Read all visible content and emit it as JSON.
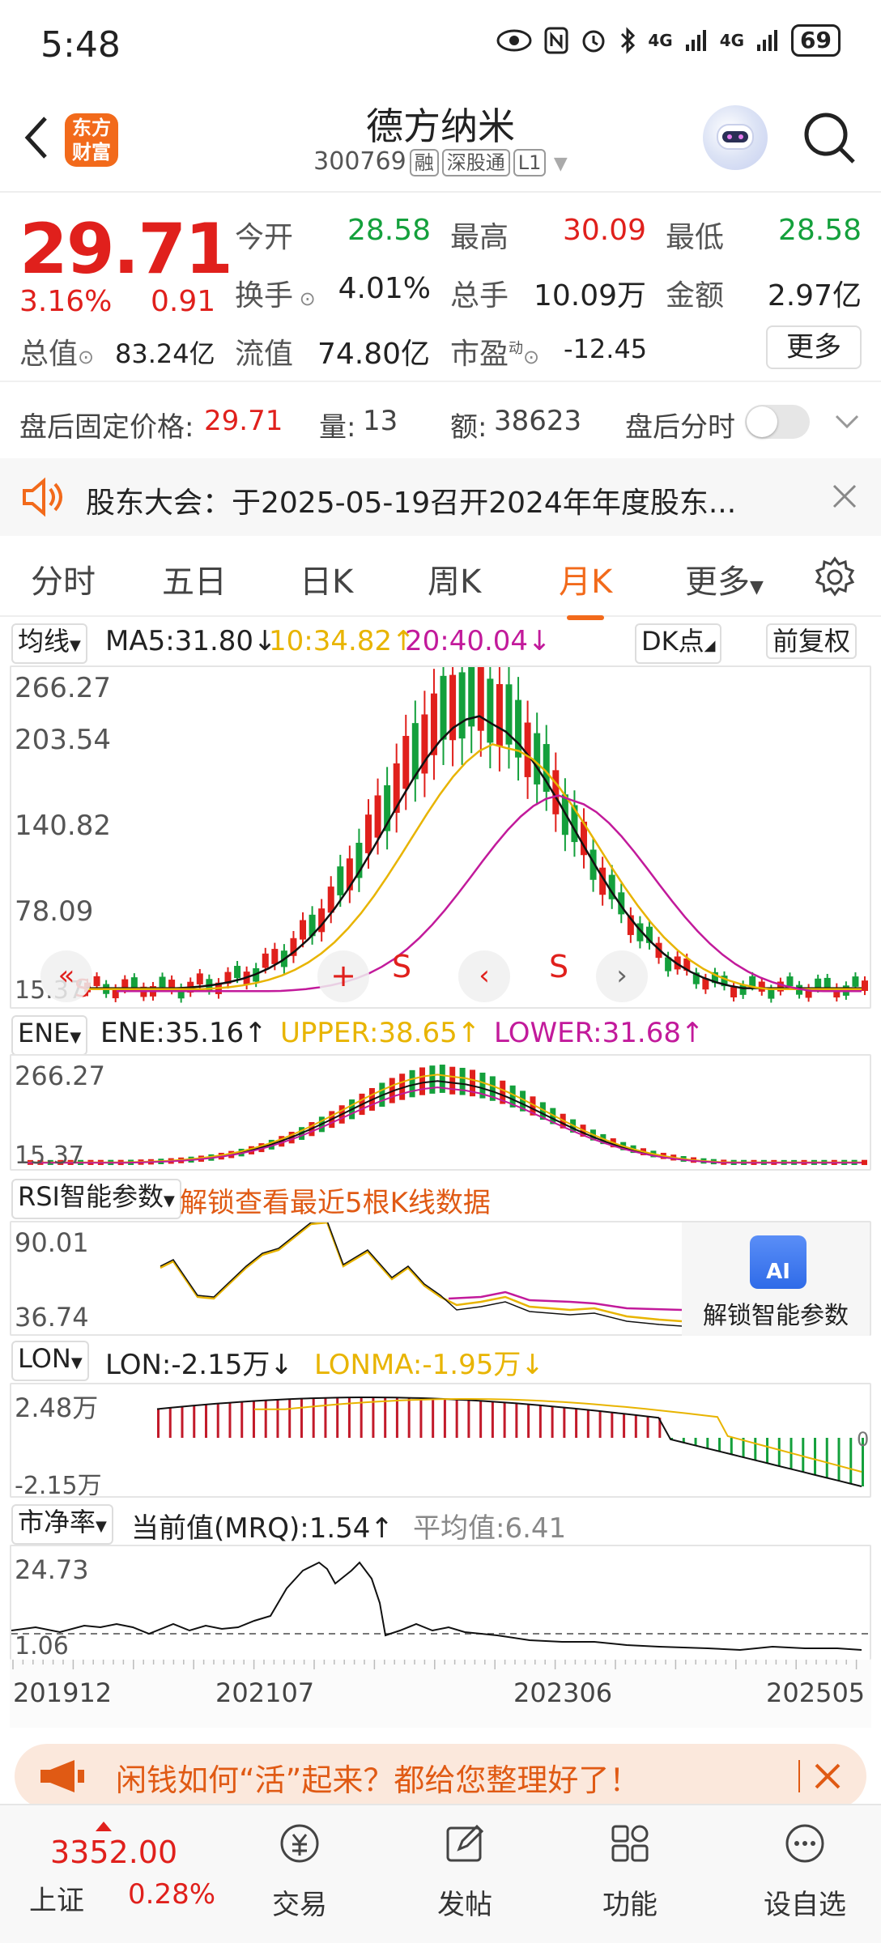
{
  "status_bar": {
    "time": "5:48",
    "battery": "69",
    "signal1": "4G",
    "signal2": "4G"
  },
  "header": {
    "logo_line1": "东方",
    "logo_line2": "财富",
    "title": "德方纳米",
    "code": "300769",
    "tags": [
      "融",
      "深股通",
      "L1"
    ]
  },
  "quote": {
    "price": "29.71",
    "change_pct": "3.16%",
    "change": "0.91",
    "open_label": "今开",
    "open": "28.58",
    "high_label": "最高",
    "high": "30.09",
    "low_label": "最低",
    "low": "28.58",
    "turnover_label": "换手",
    "turnover": "4.01%",
    "volume_label": "总手",
    "volume": "10.09万",
    "amount_label": "金额",
    "amount": "2.97亿",
    "mktcap_label": "总值",
    "mktcap": "83.24亿",
    "float_label": "流值",
    "float_cap": "74.80亿",
    "pe_label": "市盈",
    "pe_sup": "动",
    "pe": "-12.45",
    "more": "更多"
  },
  "after_hours": {
    "price_label": "盘后固定价格:",
    "price": "29.71",
    "vol_label": "量:",
    "vol": "13",
    "amt_label": "额:",
    "amt": "38623",
    "timeshare_label": "盘后分时"
  },
  "notice": {
    "text": "股东大会：于2025-05-19召开2024年年度股东..."
  },
  "tabs": [
    "分时",
    "五日",
    "日K",
    "周K",
    "月K",
    "更多"
  ],
  "active_tab": "月K",
  "ma_bar": {
    "selector": "均线",
    "ma5": "MA5:31.80↓",
    "ma10": "10:34.82↑",
    "ma20": "20:40.04↓",
    "dk": "DK点",
    "adj": "前复权"
  },
  "kline_axis": [
    "266.27",
    "203.54",
    "140.82",
    "78.09",
    "15.37"
  ],
  "kline_markers": [
    "S",
    "S",
    "S"
  ],
  "ene_bar": {
    "selector": "ENE",
    "ene": "ENE:35.16↑",
    "upper": "UPPER:38.65↑",
    "lower": "LOWER:31.68↑"
  },
  "ene_axis": [
    "266.27",
    "15.37"
  ],
  "rsi_bar": {
    "selector": "RSI智能参数",
    "unlock": "解锁查看最近5根K线数据"
  },
  "rsi_axis": [
    "90.01",
    "36.74"
  ],
  "rsi_ai": {
    "badge": "AI",
    "label": "解锁智能参数"
  },
  "lon_bar": {
    "selector": "LON",
    "lon": "LON:-2.15万↓",
    "lonma": "LONMA:-1.95万↓"
  },
  "lon_axis": [
    "2.48万",
    "-2.15万",
    "0"
  ],
  "pb_bar": {
    "selector": "市净率",
    "current": "当前值(MRQ):1.54↑",
    "avg": "平均值:6.41"
  },
  "pb_axis": [
    "24.73",
    "1.06"
  ],
  "x_dates": [
    "201912",
    "202107",
    "202306",
    "202505"
  ],
  "banner": {
    "text": "闲钱如何“活”起来？都给您整理好了！"
  },
  "bottom_nav": {
    "index_value": "3352.00",
    "index_name": "上证",
    "index_change": "0.28%",
    "items": [
      "交易",
      "发帖",
      "功能",
      "设自选"
    ]
  },
  "colors": {
    "up": "#e0201c",
    "down": "#14a03c",
    "accent": "#f26a1b",
    "ma10": "#e8b400",
    "ma20": "#c21a9b"
  }
}
